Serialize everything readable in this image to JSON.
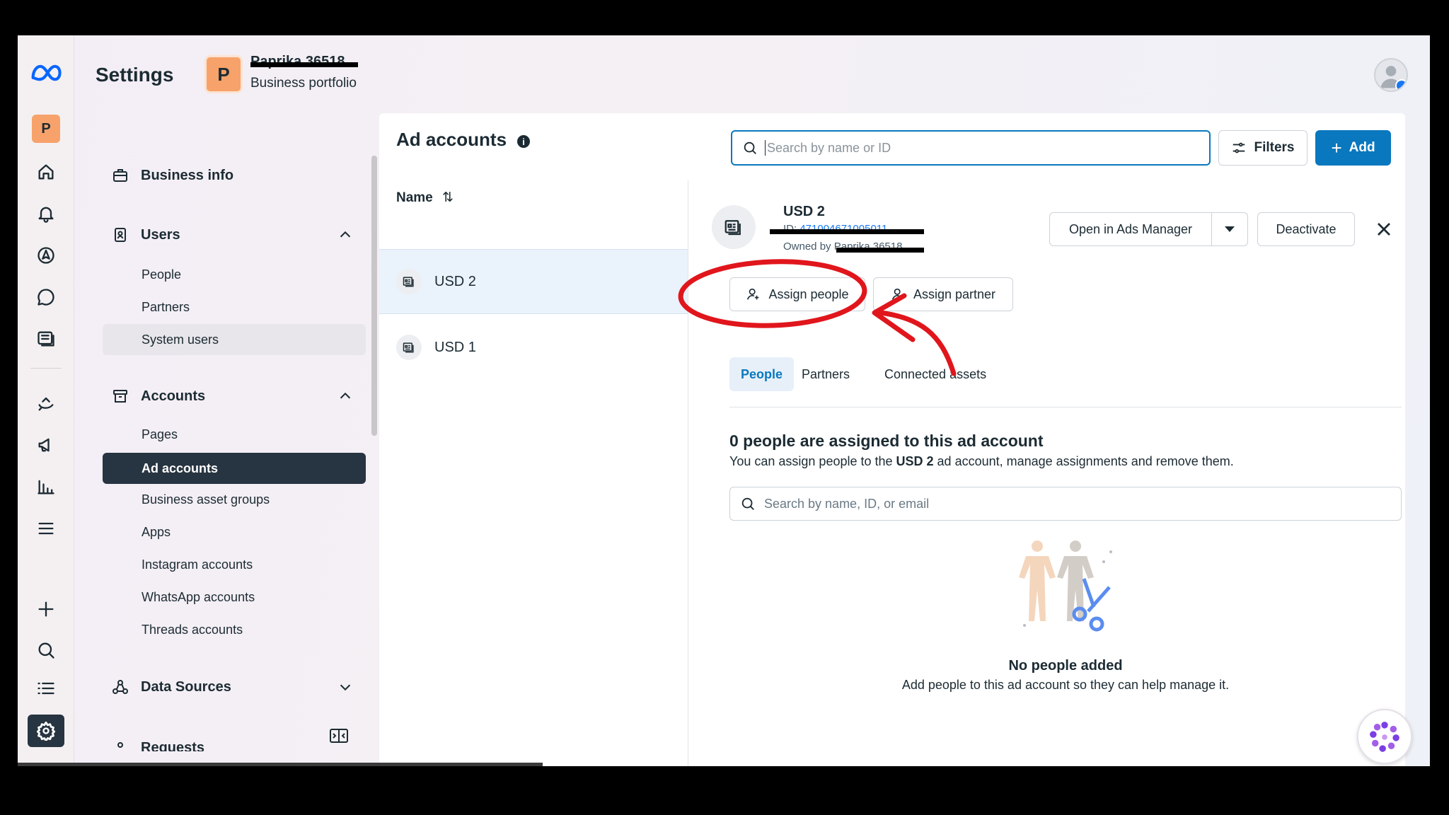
{
  "header": {
    "title": "Settings",
    "portfolio_initial": "P",
    "portfolio_name": "Paprika 36518",
    "portfolio_sub": "Business portfolio"
  },
  "rail": {
    "workspace_initial": "P"
  },
  "sidebar": {
    "business_info": "Business info",
    "users": {
      "label": "Users",
      "items": [
        "People",
        "Partners",
        "System users"
      ]
    },
    "accounts": {
      "label": "Accounts",
      "items": [
        "Pages",
        "Ad accounts",
        "Business asset groups",
        "Apps",
        "Instagram accounts",
        "WhatsApp accounts",
        "Threads accounts"
      ]
    },
    "data_sources": "Data Sources",
    "requests": "Requests"
  },
  "list": {
    "title": "Ad accounts",
    "info_glyph": "i",
    "search_placeholder": "Search by name or ID",
    "filters_label": "Filters",
    "add_label": "Add",
    "column_name": "Name",
    "sort_glyph": "⇅",
    "accounts": [
      "USD 2",
      "USD 1"
    ]
  },
  "detail": {
    "name": "USD 2",
    "id_prefix": "ID: ",
    "id_value": "471004671005011",
    "owner_prefix": "Owned by ",
    "owner_value": "Paprika 36518",
    "open_ads_manager": "Open in Ads Manager",
    "deactivate": "Deactivate",
    "assign_people": "Assign people",
    "assign_partner": "Assign partner",
    "tabs": [
      "People",
      "Partners",
      "Connected assets"
    ],
    "empty_title": "0 people are assigned to this ad account",
    "empty_sub_prefix": "You can assign people to the ",
    "empty_sub_account": "USD 2",
    "empty_sub_suffix": " ad account, manage assignments and remove them.",
    "people_search_placeholder": "Search by name, ID, or email",
    "no_people_title": "No people added",
    "no_people_sub": "Add people to this ad account so they can help manage it."
  },
  "colors": {
    "accent": "#0a78be",
    "active_nav": "#273441",
    "annotation": "#e0161c"
  }
}
